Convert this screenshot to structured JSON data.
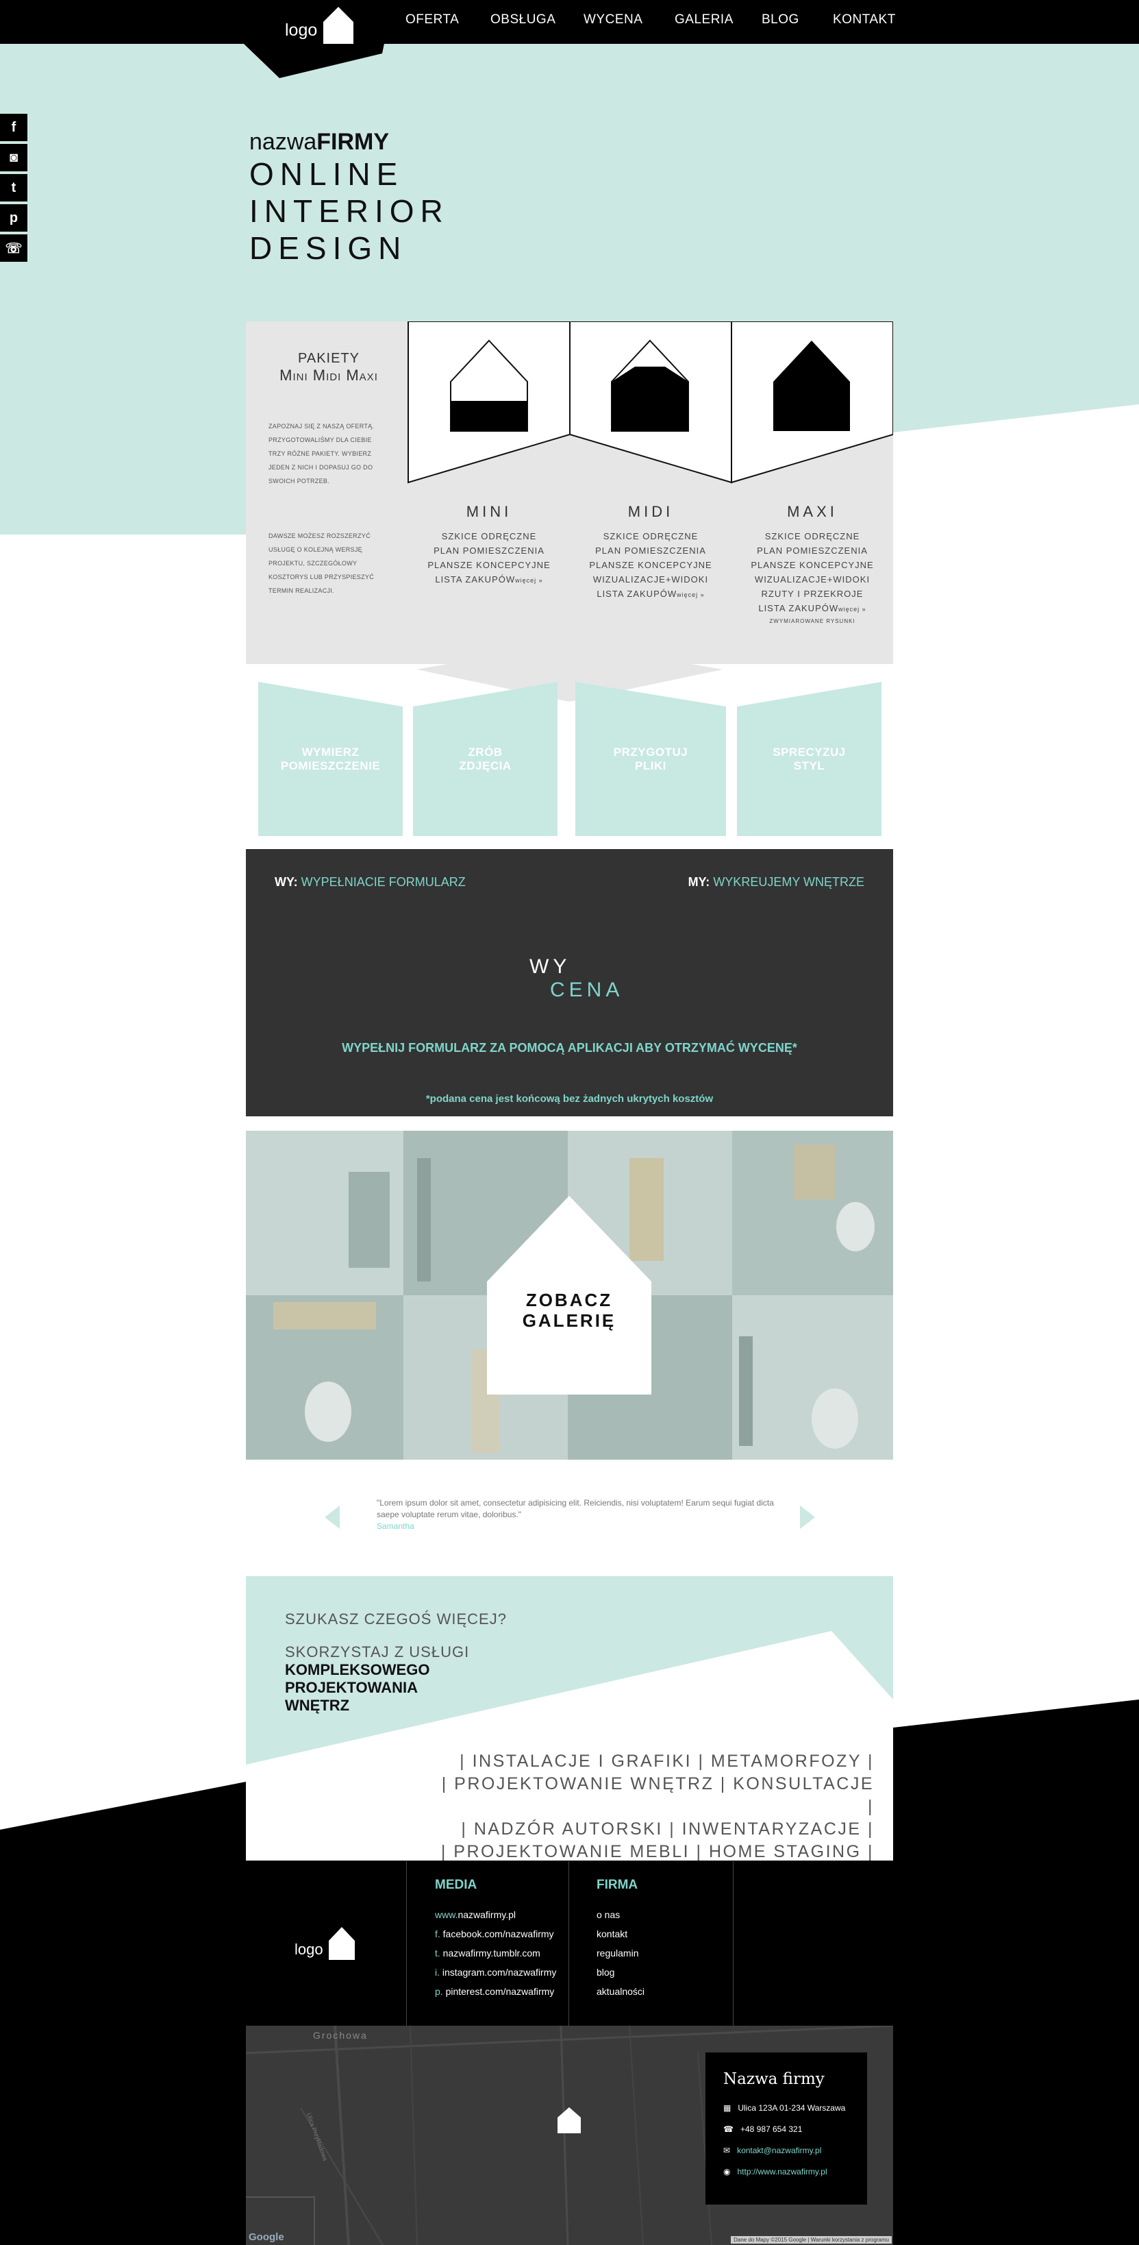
{
  "nav": {
    "logo": "logo",
    "items": [
      "OFERTA",
      "OBSŁUGA",
      "WYCENA",
      "GALERIA",
      "BLOG",
      "KONTAKT"
    ]
  },
  "social": [
    "f",
    "◙",
    "t",
    "p",
    "☏"
  ],
  "hero": {
    "brand_light": "nazwa",
    "brand_bold": "FIRMY",
    "lines": [
      "ONLINE",
      "INTERIOR",
      "DESIGN"
    ]
  },
  "packages": {
    "title_line1": "PAKIETY",
    "title_line2": "Mini Midi Maxi",
    "intro": [
      "ZAPOZNAJ SIĘ Z NASZĄ OFERTĄ.",
      "PRZYGOTOWALIŚMY DLA CIEBIE",
      "TRZY RÓŻNE PAKIETY. WYBIERZ",
      "JEDEN Z NICH I DOPASUJ GO DO",
      "SWOICH POTRZEB."
    ],
    "extra": [
      "DAWSZE MOŻESZ ROZSZERZYĆ",
      "USŁUGĘ O KOLEJNĄ WERSJĘ",
      "PROJEKTU, SZCZEGÓŁOWY",
      "KOSZTORYS LUB PRZYSPIESZYĆ",
      "TERMIN REALIZACJI."
    ],
    "cols": [
      {
        "name": "MINI",
        "items": [
          "SZKICE ODRĘCZNE",
          "PLAN POMIESZCZENIA",
          "PLANSZE KONCEPCYJNE",
          "LISTA ZAKUPÓW"
        ],
        "more": "więcej »"
      },
      {
        "name": "MIDI",
        "items": [
          "SZKICE ODRĘCZNE",
          "PLAN POMIESZCZENIA",
          "PLANSZE KONCEPCYJNE",
          "WIZUALIZACJE+WIDOKI",
          "LISTA ZAKUPÓW"
        ],
        "more": "więcej »"
      },
      {
        "name": "MAXI",
        "items": [
          "SZKICE ODRĘCZNE",
          "PLAN POMIESZCZENIA",
          "PLANSZE KONCEPCYJNE",
          "WIZUALIZACJE+WIDOKI",
          "RZUTY I PRZEKROJE",
          "LISTA ZAKUPÓW"
        ],
        "more": "więcej »",
        "note": "ZWYMIAROWANE RYSUNKI"
      }
    ]
  },
  "steps": [
    {
      "l1": "WYMIERZ",
      "l2": "POMIESZCZENIE"
    },
    {
      "l1": "ZRÓB",
      "l2": "ZDJĘCIA"
    },
    {
      "l1": "PRZYGOTUJ",
      "l2": "PLIKI"
    },
    {
      "l1": "SPRECYZUJ",
      "l2": "STYL"
    }
  ],
  "wycena": {
    "left_prefix": "WY:",
    "left_text": "WYPEŁNIACIE FORMULARZ",
    "right_prefix": "MY:",
    "right_text": "WYKREUJEMY WNĘTRZE",
    "logo_top": "WY",
    "logo_bottom": "CENA",
    "cta": "WYPEŁNIJ FORMULARZ ZA POMOCĄ APLIKACJI ABY OTRZYMAĆ WYCENĘ*",
    "note": "*podana cena jest końcową bez żadnych ukrytych kosztów"
  },
  "gallery": {
    "line1": "ZOBACZ",
    "line2": "GALERIĘ"
  },
  "testimonial": {
    "text": "\"Lorem ipsum dolor sit amet, consectetur adipisicing elit. Reiciendis, nisi voluptatem! Earum sequi fugiat dicta saepe voluptate rerum vitae, doloribus.\"",
    "author": "Samantha"
  },
  "more": {
    "q": "SZUKASZ CZEGOŚ WIĘCEJ?",
    "l1": "SKORZYSTAJ Z USŁUGI",
    "l2": "KOMPLEKSOWEGO",
    "l3": "PROJEKTOWANIA",
    "l4": "WNĘTRZ",
    "services": [
      "| INSTALACJE I GRAFIKI | METAMORFOZY |",
      "| PROJEKTOWANIE WNĘTRZ | KONSULTACJE |",
      "| NADZÓR AUTORSKI | INWENTARYZACJE |",
      "| PROJEKTOWANIE MEBLI | HOME STAGING |"
    ]
  },
  "footer": {
    "logo": "logo",
    "media_head": "MEDIA",
    "media": [
      {
        "p": "www.",
        "t": "nazwafirmy.pl"
      },
      {
        "p": "f. ",
        "t": "facebook.com/nazwafirmy"
      },
      {
        "p": "t. ",
        "t": "nazwafirmy.tumblr.com"
      },
      {
        "p": "i. ",
        "t": "instagram.com/nazwafirmy"
      },
      {
        "p": "p. ",
        "t": "pinterest.com/nazwafirmy"
      }
    ],
    "firma_head": "FIRMA",
    "firma": [
      "o nas",
      "kontakt",
      "regulamin",
      "blog",
      "aktualności"
    ]
  },
  "map": {
    "district": "Grochowa",
    "street": "Ulica Przykładowa",
    "google": "Google",
    "attribution": "Dane do Mapy ©2015 Google | Warunki korzystania z programu",
    "card": {
      "name": "Nazwa firmy",
      "address": "Ulica 123A 01-234 Warszawa",
      "phone": "+48 987 654 321",
      "email": "kontakt@nazwafirmy.pl",
      "url": "http://www.nazwafirmy.pl"
    }
  },
  "colors": {
    "accent": "#7fd5cb",
    "mint": "#cce8e3",
    "dark": "#333333",
    "black": "#000000"
  }
}
